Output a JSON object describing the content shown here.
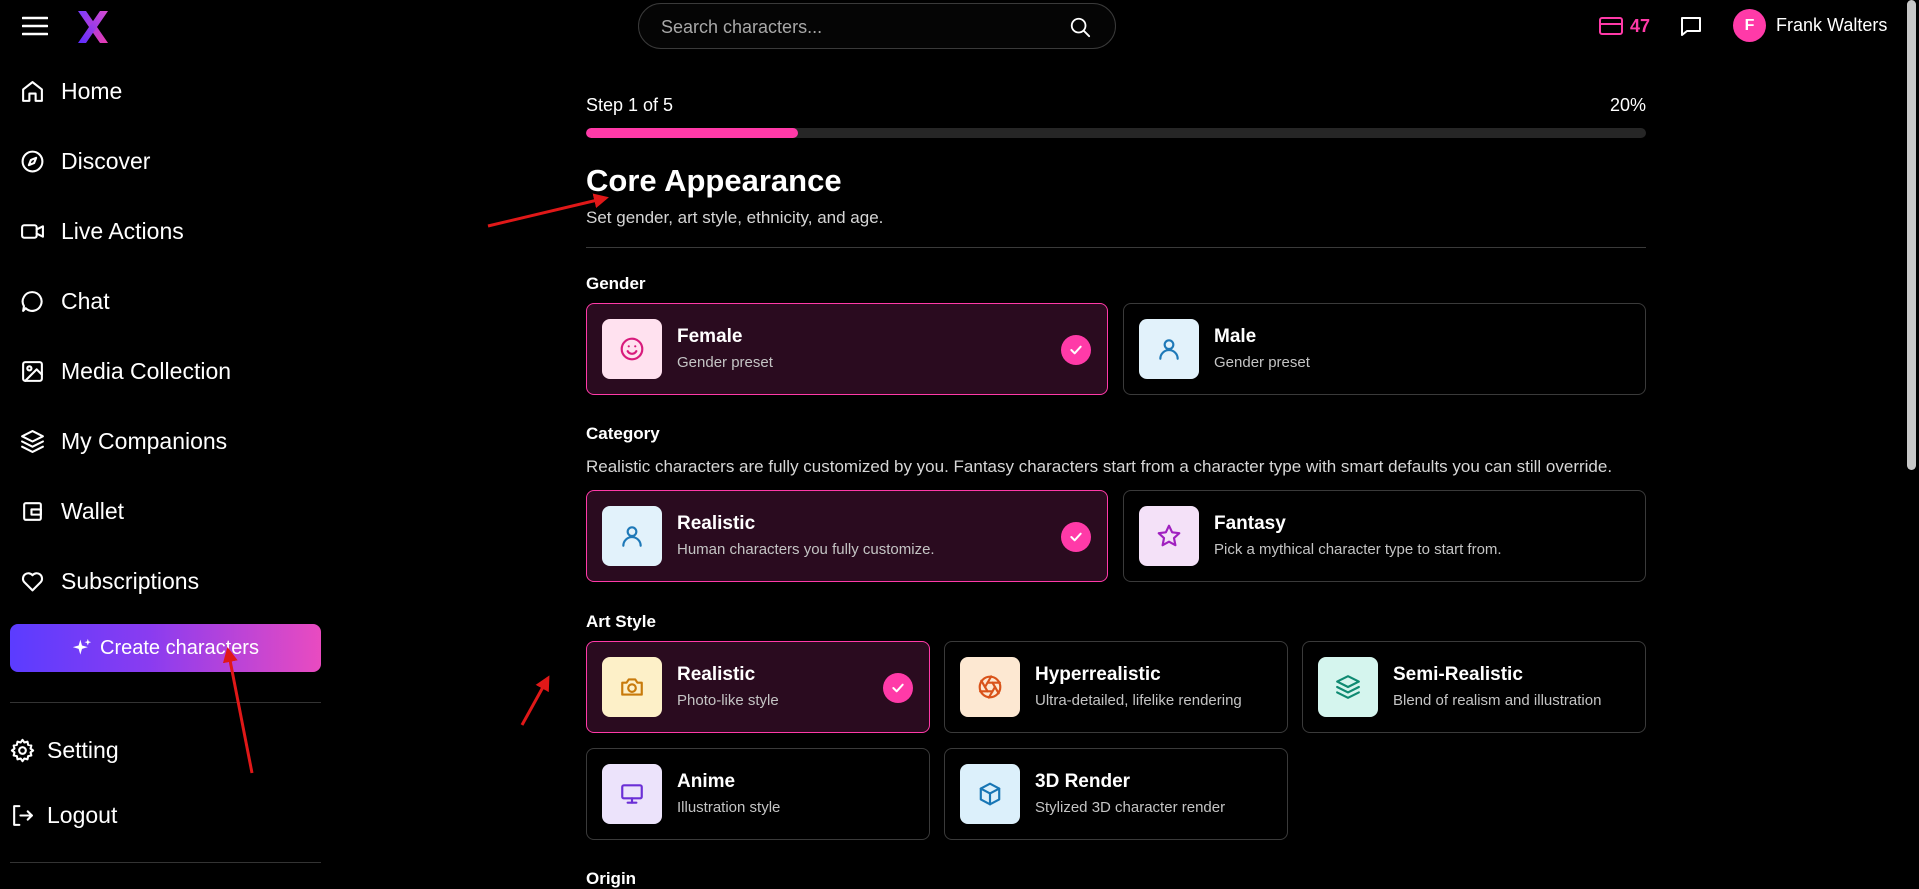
{
  "header": {
    "menu_icon": "hamburger-menu-icon",
    "logo": "X",
    "search_placeholder": "Search characters...",
    "credits": "47",
    "user_initial": "F",
    "user_name": "Frank Walters"
  },
  "sidebar": {
    "items": [
      {
        "label": "Home",
        "icon": "home-icon"
      },
      {
        "label": "Discover",
        "icon": "compass-icon"
      },
      {
        "label": "Live Actions",
        "icon": "video-icon"
      },
      {
        "label": "Chat",
        "icon": "chat-bubble-icon"
      },
      {
        "label": "Media Collection",
        "icon": "image-icon"
      },
      {
        "label": "My Companions",
        "icon": "layers-icon"
      },
      {
        "label": "Wallet",
        "icon": "wallet-icon"
      },
      {
        "label": "Subscriptions",
        "icon": "heart-icon"
      }
    ],
    "create_label": "Create characters",
    "setting_label": "Setting",
    "logout_label": "Logout"
  },
  "wizard": {
    "step_label": "Step 1 of 5",
    "percent_label": "20%",
    "progress": 0.2,
    "title": "Core Appearance",
    "subtitle": "Set gender, art style, ethnicity, and age.",
    "gender": {
      "label": "Gender",
      "options": [
        {
          "title": "Female",
          "desc": "Gender preset",
          "selected": true,
          "icon": "smile-icon"
        },
        {
          "title": "Male",
          "desc": "Gender preset",
          "selected": false,
          "icon": "user-icon"
        }
      ]
    },
    "category": {
      "label": "Category",
      "help": "Realistic characters are fully customized by you. Fantasy characters start from a character type with smart defaults you can still override.",
      "options": [
        {
          "title": "Realistic",
          "desc": "Human characters you fully customize.",
          "selected": true,
          "icon": "user-icon"
        },
        {
          "title": "Fantasy",
          "desc": "Pick a mythical character type to start from.",
          "selected": false,
          "icon": "star-icon"
        }
      ]
    },
    "art_style": {
      "label": "Art Style",
      "options": [
        {
          "title": "Realistic",
          "desc": "Photo-like style",
          "selected": true,
          "icon": "camera-icon"
        },
        {
          "title": "Hyperrealistic",
          "desc": "Ultra-detailed, lifelike rendering",
          "selected": false,
          "icon": "aperture-icon"
        },
        {
          "title": "Semi-Realistic",
          "desc": "Blend of realism and illustration",
          "selected": false,
          "icon": "layers-icon"
        },
        {
          "title": "Anime",
          "desc": "Illustration style",
          "selected": false,
          "icon": "monitor-icon"
        },
        {
          "title": "3D Render",
          "desc": "Stylized 3D character render",
          "selected": false,
          "icon": "cube-icon"
        }
      ]
    },
    "next_section_label": "Origin"
  },
  "colors": {
    "accent_pink": "#ff3aa8",
    "selected_card_bg": "#2a0b1f",
    "create_gradient_start": "#5b3cff",
    "create_gradient_end": "#e94bc0",
    "annotation_red": "#e01818"
  }
}
